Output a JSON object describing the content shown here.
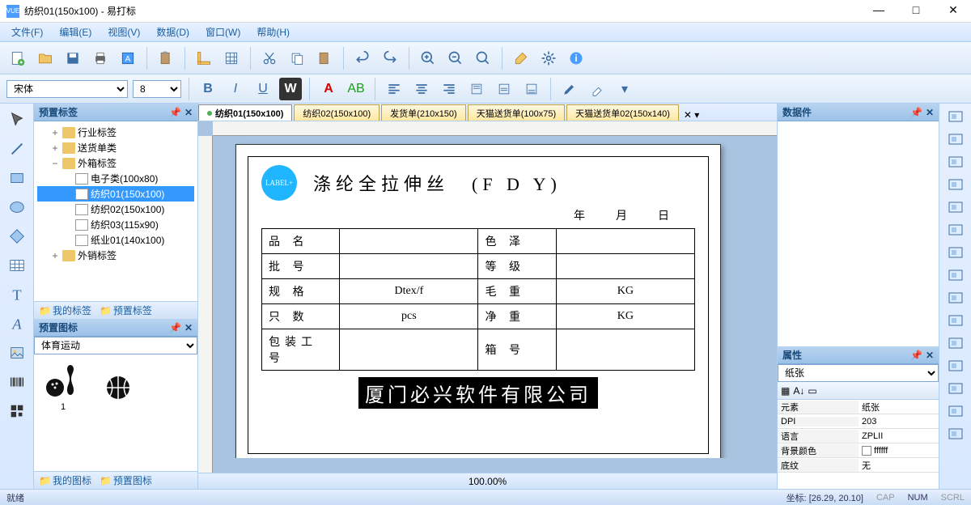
{
  "title": "纺织01(150x100) - 易打标",
  "app_icon_text": "VUE",
  "menu": [
    "文件(F)",
    "编辑(E)",
    "视图(V)",
    "数据(D)",
    "窗口(W)",
    "帮助(H)"
  ],
  "font": {
    "name": "宋体",
    "size": "8"
  },
  "tabs": [
    {
      "label": "纺织01(150x100)",
      "active": true
    },
    {
      "label": "纺织02(150x100)",
      "active": false
    },
    {
      "label": "发货单(210x150)",
      "active": false
    },
    {
      "label": "天猫送货单(100x75)",
      "active": false
    },
    {
      "label": "天猫送货单02(150x140)",
      "active": false
    }
  ],
  "zoom": "100.00%",
  "panels": {
    "preset_labels": "预置标签",
    "preset_icons": "预置图标",
    "data": "数据件",
    "props": "属性"
  },
  "tree": [
    {
      "indent": 1,
      "toggle": "+",
      "type": "folder",
      "label": "行业标签"
    },
    {
      "indent": 1,
      "toggle": "+",
      "type": "folder",
      "label": "送货单类"
    },
    {
      "indent": 1,
      "toggle": "−",
      "type": "folder",
      "label": "外箱标签"
    },
    {
      "indent": 2,
      "toggle": "",
      "type": "file",
      "label": "电子类(100x80)"
    },
    {
      "indent": 2,
      "toggle": "",
      "type": "file",
      "label": "纺织01(150x100)",
      "selected": true
    },
    {
      "indent": 2,
      "toggle": "",
      "type": "file",
      "label": "纺织02(150x100)"
    },
    {
      "indent": 2,
      "toggle": "",
      "type": "file",
      "label": "纺织03(115x90)"
    },
    {
      "indent": 2,
      "toggle": "",
      "type": "file",
      "label": "纸业01(140x100)"
    },
    {
      "indent": 1,
      "toggle": "+",
      "type": "folder",
      "label": "外销标签"
    }
  ],
  "footer_links": {
    "my_labels": "我的标签",
    "preset_labels": "预置标签",
    "my_icons": "我的图标",
    "preset_icons": "预置图标"
  },
  "icon_category": "体育运动",
  "gallery": [
    {
      "label": "1"
    }
  ],
  "label": {
    "logo": "LABEL+",
    "title": "涤纶全拉伸丝　(F D Y)",
    "date": "年　月　日",
    "rows": [
      {
        "l": "品 名",
        "lv": "",
        "r": "色 泽",
        "rv": ""
      },
      {
        "l": "批 号",
        "lv": "",
        "r": "等 级",
        "rv": ""
      },
      {
        "l": "规 格",
        "lv": "Dtex/f",
        "r": "毛 重",
        "rv": "KG"
      },
      {
        "l": "只 数",
        "lv": "pcs",
        "r": "净 重",
        "rv": "KG"
      },
      {
        "l": "包装工号",
        "lv": "",
        "r": "箱 号",
        "rv": ""
      }
    ],
    "company": "厦门必兴软件有限公司"
  },
  "props": {
    "selector": "纸张",
    "rows": [
      {
        "k": "元素",
        "v": "纸张"
      },
      {
        "k": "DPI",
        "v": "203"
      },
      {
        "k": "语言",
        "v": "ZPLII"
      },
      {
        "k": "背景颜色",
        "v": "ffffff",
        "color": true
      },
      {
        "k": "底纹",
        "v": "无"
      }
    ]
  },
  "status": {
    "ready": "就绪",
    "coord_label": "坐标:",
    "coord": "[26.29, 20.10]",
    "caps": "CAP",
    "num": "NUM",
    "scrl": "SCRL"
  }
}
